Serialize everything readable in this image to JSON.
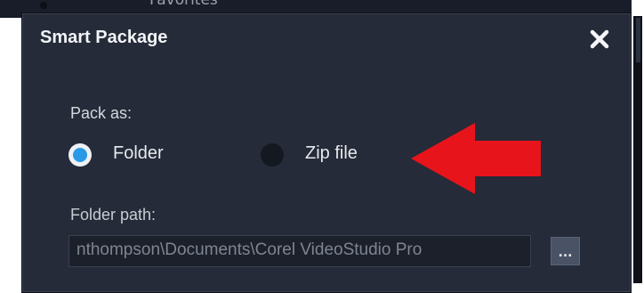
{
  "background": {
    "partial_text": "Favorites"
  },
  "dialog": {
    "title": "Smart Package",
    "close_icon": "close-icon",
    "pack_as_label": "Pack as:",
    "options": [
      {
        "label": "Folder",
        "selected": true
      },
      {
        "label": "Zip file",
        "selected": false
      }
    ],
    "folder_path_label": "Folder path:",
    "folder_path_value": "nthompson\\Documents\\Corel VideoStudio Pro",
    "browse_label": "..."
  },
  "annotation": {
    "arrow_icon": "red-arrow-icon",
    "arrow_color": "#e8141b"
  },
  "colors": {
    "dialog_bg": "#252b38",
    "radio_accent": "#2a99e6"
  }
}
